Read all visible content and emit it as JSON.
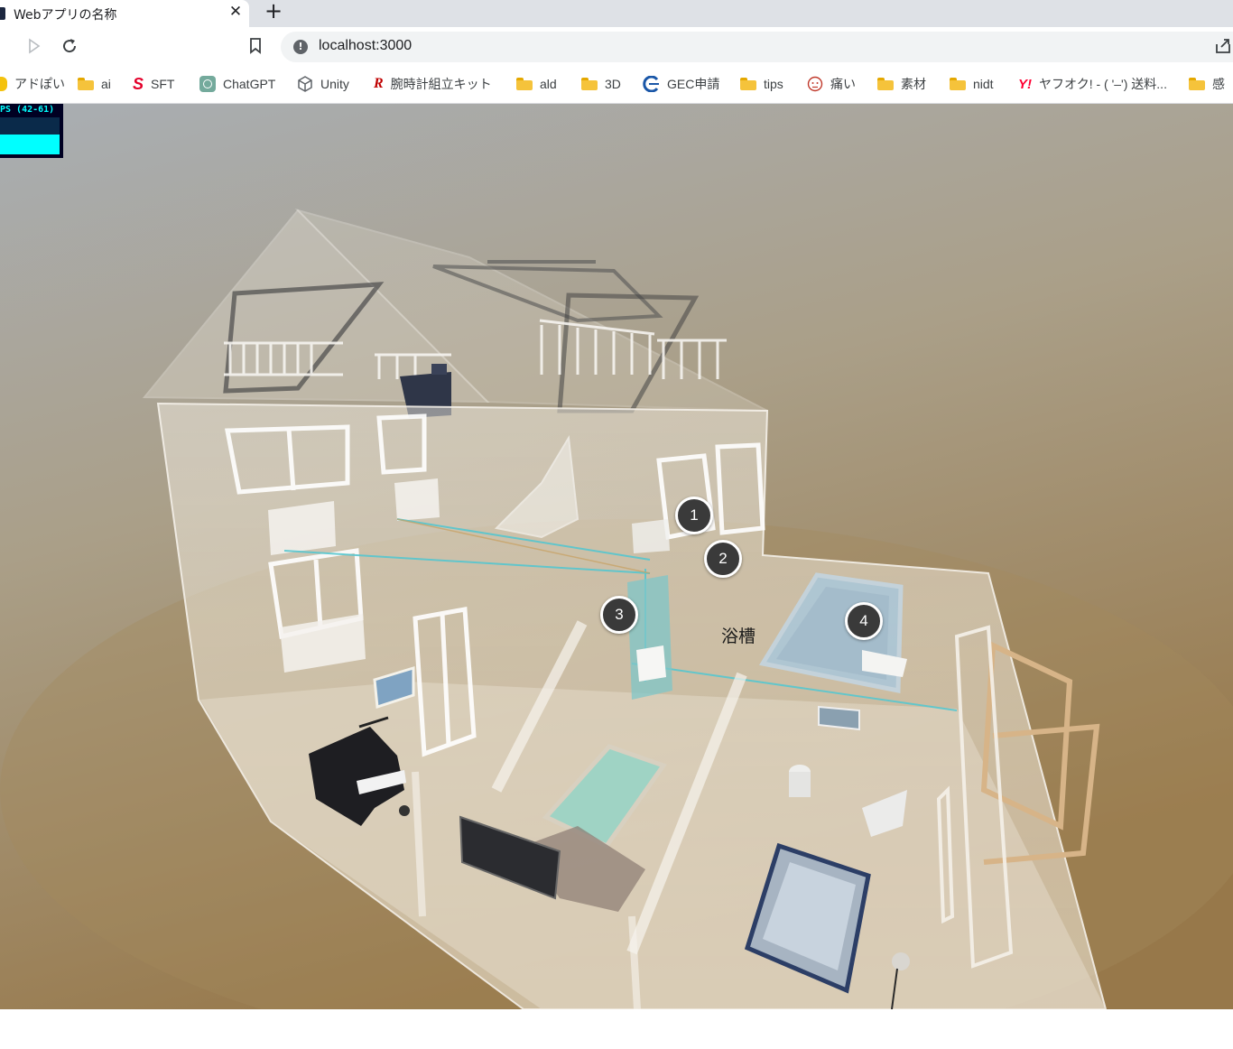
{
  "tab": {
    "title": "Webアプリの名称",
    "close_glyph": "✕",
    "new_tab_glyph": "+"
  },
  "omnibox": {
    "info_glyph": "!",
    "url": "localhost:3000"
  },
  "bookmarks": [
    {
      "label": "アドぽい",
      "icon": "yellow-app-icon"
    },
    {
      "label": "ai",
      "icon": "folder-icon"
    },
    {
      "label": "SFT",
      "icon": "sft-logo-icon"
    },
    {
      "label": "ChatGPT",
      "icon": "chatgpt-icon"
    },
    {
      "label": "Unity",
      "icon": "unity-icon"
    },
    {
      "label": "腕時計組立キット",
      "icon": "rakuten-icon"
    },
    {
      "label": "ald",
      "icon": "folder-icon"
    },
    {
      "label": "3D",
      "icon": "folder-icon"
    },
    {
      "label": "GEC申請",
      "icon": "gec-icon"
    },
    {
      "label": "tips",
      "icon": "folder-icon"
    },
    {
      "label": "痛い",
      "icon": "face-icon"
    },
    {
      "label": "素材",
      "icon": "folder-icon"
    },
    {
      "label": "nidt",
      "icon": "folder-icon"
    },
    {
      "label": "ヤフオク! - ( '–') 送料...",
      "icon": "yahoo-icon"
    },
    {
      "label": "感",
      "icon": "folder-icon"
    }
  ],
  "stats": {
    "fps_text": "PS (42-61)"
  },
  "scene": {
    "markers": [
      "1",
      "2",
      "3",
      "4"
    ],
    "bath_label": "浴槽",
    "colors": {
      "bg_top": "#a7acb1",
      "bg_bottom": "#9c7f4e",
      "accent_cyan": "#00ffff",
      "marker_fill": "#3a3a3a"
    }
  }
}
